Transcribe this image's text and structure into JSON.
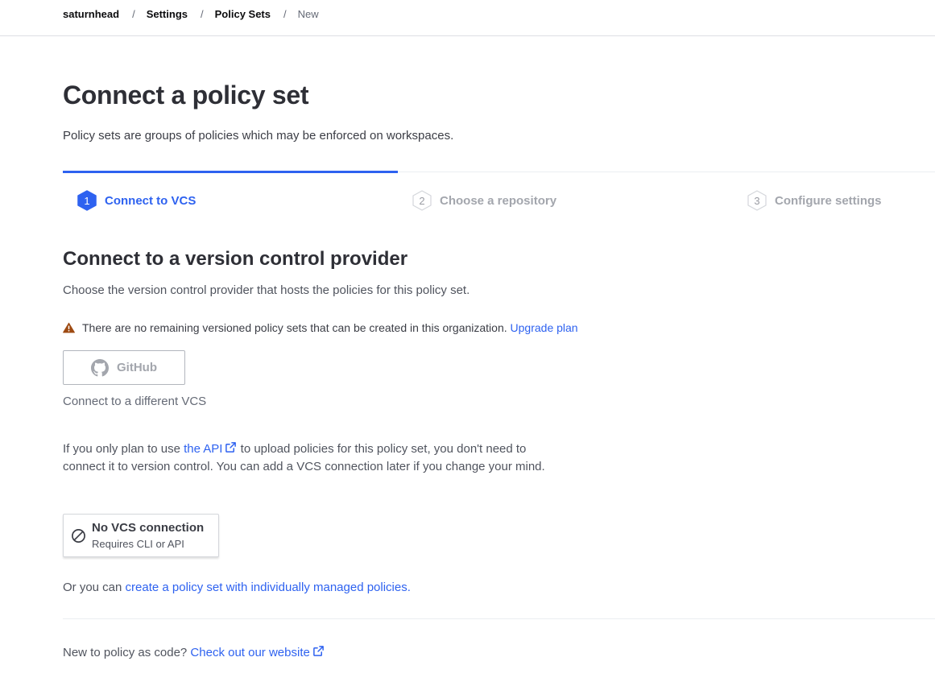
{
  "breadcrumb": {
    "items": [
      {
        "label": "saturnhead"
      },
      {
        "label": "Settings"
      },
      {
        "label": "Policy Sets"
      },
      {
        "label": "New"
      }
    ],
    "separator": "/"
  },
  "header": {
    "title": "Connect a policy set",
    "description": "Policy sets are groups of policies which may be enforced on workspaces."
  },
  "stepper": {
    "active_step": 1,
    "steps": [
      {
        "number": "1",
        "label": "Connect to VCS"
      },
      {
        "number": "2",
        "label": "Choose a repository"
      },
      {
        "number": "3",
        "label": "Configure settings"
      }
    ]
  },
  "section": {
    "title": "Connect to a version control provider",
    "description": "Choose the version control provider that hosts the policies for this policy set."
  },
  "warning": {
    "icon": "warning-triangle-icon",
    "text": "There are no remaining versioned policy sets that can be created in this organization.",
    "link_label": "Upgrade plan"
  },
  "vcs": {
    "github_label": "GitHub",
    "github_icon": "github-icon",
    "different_vcs_label": "Connect to a different VCS"
  },
  "api_paragraph": {
    "prefix": "If you only plan to use ",
    "link_label": "the API",
    "suffix": " to upload policies for this policy set, you don't need to connect it to version control. You can add a VCS connection later if you change your mind."
  },
  "no_vcs": {
    "icon": "prohibited-icon",
    "title": "No VCS connection",
    "subtitle": "Requires CLI or API"
  },
  "alternative": {
    "prefix": "Or you can ",
    "link_label": "create a policy set with individually managed policies."
  },
  "footer": {
    "prefix": "New to policy as code? ",
    "link_label": "Check out our website"
  },
  "colors": {
    "accent": "#2e62f0",
    "warning": "#9e4b13",
    "muted": "#a3a6ad",
    "text": "#3b3d45"
  }
}
